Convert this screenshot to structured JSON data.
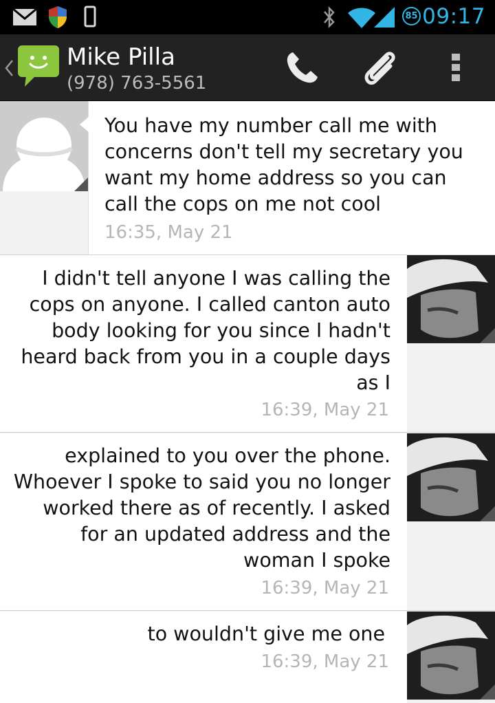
{
  "status_bar": {
    "time": "09:17",
    "battery_level": "85",
    "icons": [
      "mail-icon",
      "shield-icon",
      "phone-storage-icon",
      "bluetooth-icon",
      "wifi-icon",
      "signal-icon"
    ],
    "accent_color": "#33b5e5"
  },
  "header": {
    "contact_name": "Mike Pilla",
    "contact_number": "(978) 763-5561",
    "actions": [
      "call-icon",
      "attach-icon",
      "overflow-menu-icon"
    ]
  },
  "messages": [
    {
      "direction": "incoming",
      "lines": [
        "You have my number call me with",
        "concerns don't tell my secretary you",
        "want my home address so you can",
        "call the cops on me not cool"
      ],
      "time": "16:35, May 21"
    },
    {
      "direction": "outgoing",
      "lines": [
        "I didn't tell anyone I was calling the",
        "cops on anyone. I called canton auto",
        "body looking for you since I hadn't",
        "heard back from you in a couple days",
        "as I"
      ],
      "time": "16:39, May 21"
    },
    {
      "direction": "outgoing",
      "lines": [
        "explained to you over the phone.",
        "Whoever I spoke to said you no longer",
        "worked there as of recently. I asked",
        "for an updated address and the",
        "woman I spoke"
      ],
      "time": "16:39, May 21"
    },
    {
      "direction": "outgoing",
      "lines": [
        "to wouldn't give me one"
      ],
      "time": "16:39, May 21"
    }
  ]
}
